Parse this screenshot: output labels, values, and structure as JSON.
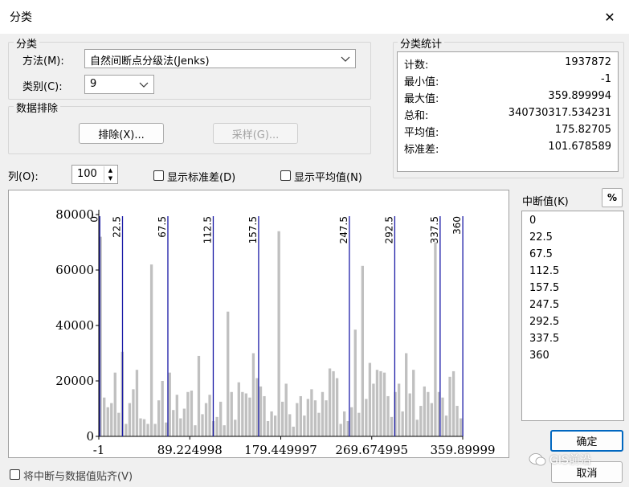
{
  "window": {
    "title": "分类",
    "close_glyph": "✕"
  },
  "classification": {
    "group_title": "分类",
    "method_label": "方法(M):",
    "method_value": "自然间断点分级法(Jenks)",
    "classes_label": "类别(C):",
    "classes_value": "9"
  },
  "exclusion": {
    "group_title": "数据排除",
    "exclude_button": "排除(X)...",
    "sample_button": "采样(G)..."
  },
  "stats": {
    "group_title": "分类统计",
    "rows": [
      {
        "key": "计数:",
        "value": "1937872"
      },
      {
        "key": "最小值:",
        "value": "-1"
      },
      {
        "key": "最大值:",
        "value": "359.899994"
      },
      {
        "key": "总和:",
        "value": "340730317.534231"
      },
      {
        "key": "平均值:",
        "value": "175.82705"
      },
      {
        "key": "标准差:",
        "value": "101.678589"
      }
    ]
  },
  "controls": {
    "columns_label": "列(O):",
    "columns_value": "100",
    "show_std_label": "显示标准差(D)",
    "show_mean_label": "显示平均值(N)",
    "show_std_checked": false,
    "show_mean_checked": false,
    "snap_label": "将中断与数据值贴齐(V)",
    "snap_checked": false
  },
  "breaks": {
    "title": "中断值(K)",
    "percent_button": "%",
    "values": [
      "0",
      "22.5",
      "67.5",
      "112.5",
      "157.5",
      "247.5",
      "292.5",
      "337.5",
      "360"
    ]
  },
  "buttons": {
    "ok": "确定",
    "cancel": "取消"
  },
  "watermark": "GIS前沿",
  "colors": {
    "bar": "#c0c0c0",
    "break_line": "#1a1aa6",
    "ok_border": "#0067c0"
  },
  "chart_data": {
    "type": "bar",
    "x_tick_labels": [
      "-1",
      "89.224998",
      "179.449997",
      "269.674995",
      "359.89999"
    ],
    "y_tick_labels": [
      "0",
      "20000",
      "40000",
      "60000",
      "80000"
    ],
    "xlim": [
      -1,
      359.899994
    ],
    "ylim": [
      0,
      80000
    ],
    "bin_count": 100,
    "values": [
      72000,
      14000,
      10500,
      12000,
      23000,
      8500,
      30500,
      4500,
      12000,
      17000,
      24000,
      6500,
      6200,
      4500,
      62000,
      4500,
      13000,
      20000,
      5000,
      23000,
      9500,
      15000,
      6500,
      10000,
      16000,
      16500,
      4000,
      29000,
      8000,
      12000,
      15000,
      5500,
      7000,
      12500,
      4000,
      45000,
      16000,
      6000,
      19500,
      16000,
      15500,
      14000,
      30000,
      21000,
      18000,
      14500,
      5500,
      9000,
      7500,
      74000,
      12500,
      19000,
      8000,
      3500,
      12000,
      14500,
      7500,
      13500,
      17000,
      13000,
      8500,
      16000,
      13000,
      24500,
      23500,
      21000,
      4500,
      9000,
      5500,
      10500,
      38500,
      8500,
      61500,
      13500,
      26500,
      19000,
      24000,
      23500,
      23000,
      14500,
      7000,
      16000,
      19000,
      9000,
      30000,
      15500,
      24000,
      6000,
      11000,
      18000,
      16000,
      12000,
      70000,
      16000,
      14000,
      7500,
      21500,
      23500,
      11000,
      6500
    ]
  }
}
